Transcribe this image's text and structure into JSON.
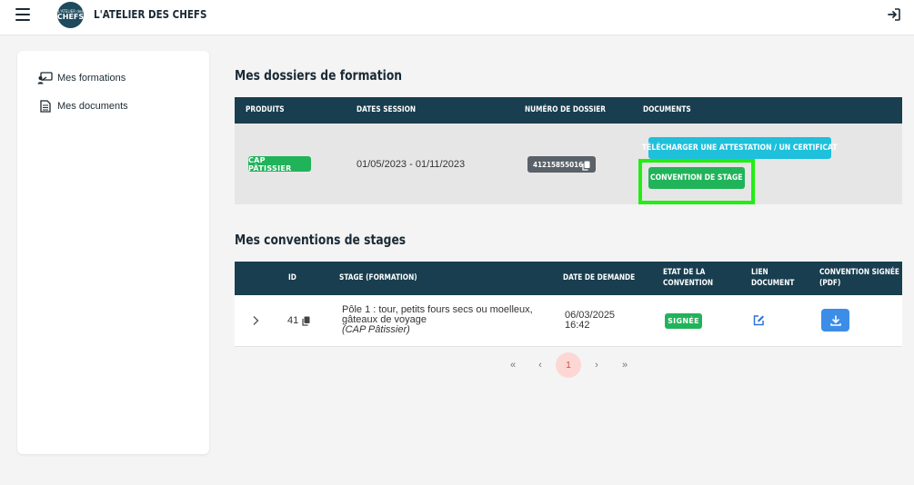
{
  "header": {
    "brand": "L'ATELIER DES CHEFS",
    "logo_line1": "L'ATELIER des",
    "logo_line2": "CHEFS"
  },
  "sidebar": {
    "items": [
      {
        "label": "Mes formations",
        "icon": "teacher-board-icon"
      },
      {
        "label": "Mes documents",
        "icon": "document-icon"
      }
    ]
  },
  "dossiers": {
    "title": "Mes dossiers de formation",
    "columns": [
      "PRODUITS",
      "DATES SESSION",
      "NUMÉRO DE DOSSIER",
      "DOCUMENTS"
    ],
    "row": {
      "product": "CAP PÂTISSIER",
      "dates": "01/05/2023 - 01/11/2023",
      "dossier_number": "41215855016",
      "btn_attestation": "TÉLÉCHARGER UNE ATTESTATION / UN CERTIFICAT",
      "btn_convention": "CONVENTION DE STAGE"
    }
  },
  "conventions": {
    "title": "Mes conventions de stages",
    "columns": {
      "id": "ID",
      "stage": "STAGE (FORMATION)",
      "date": "DATE DE DEMANDE",
      "etat_1": "ETAT DE LA",
      "etat_2": "CONVENTION",
      "lien_1": "LIEN",
      "lien_2": "DOCUMENT",
      "signed_1": "CONVENTION SIGNÉE",
      "signed_2": "(PDF)"
    },
    "row": {
      "id": "41",
      "stage_line1": "Pôle 1 : tour, petits fours secs ou moelleux,",
      "stage_line2": "gâteaux de voyage",
      "stage_line3": "(CAP Pâtissier)",
      "date_line1": "06/03/2025",
      "date_line2": "16:42",
      "status": "SIGNÉE"
    }
  },
  "pagination": {
    "first": "«",
    "prev": "‹",
    "current": "1",
    "next": "›",
    "last": "»"
  },
  "colors": {
    "header_dark": "#183e4f",
    "green": "#21b35a",
    "cyan": "#1ec0dc",
    "blue": "#3b8de8",
    "highlight": "#22ee11"
  }
}
